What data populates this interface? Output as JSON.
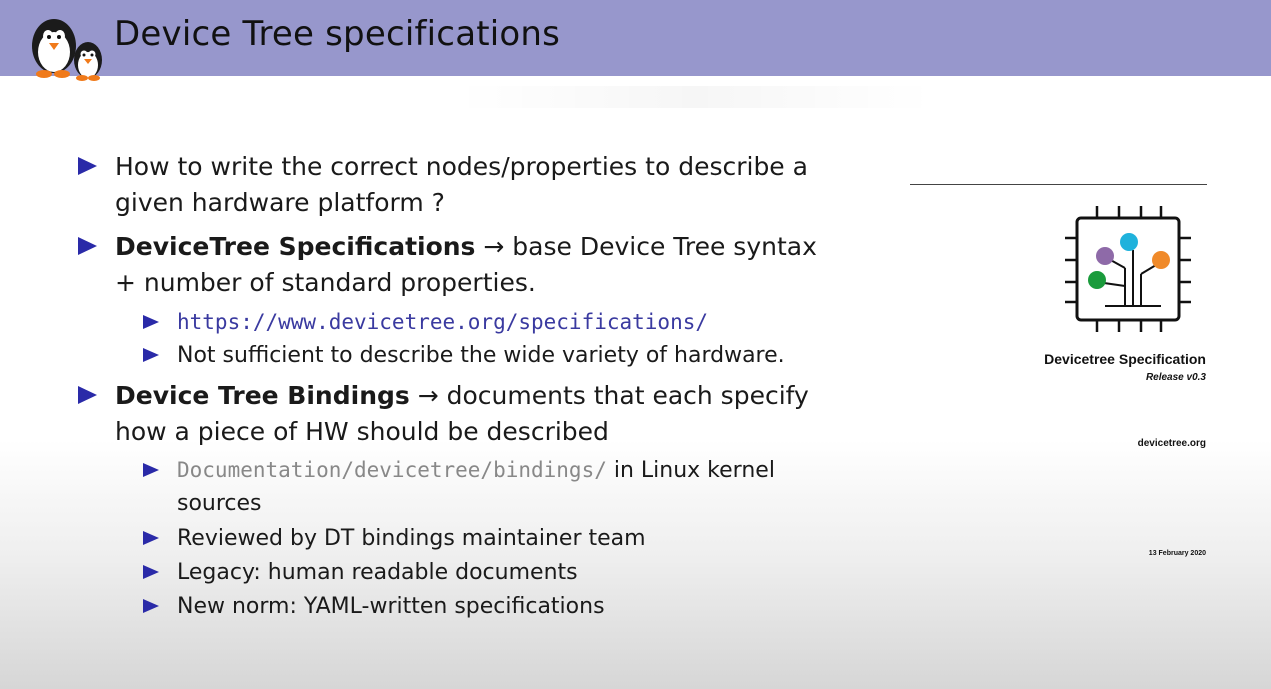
{
  "slide": {
    "title": "Device Tree specifications"
  },
  "bullets": {
    "b1": {
      "text": "How to write the correct nodes/properties to describe a given hardware platform ?"
    },
    "b2": {
      "bold": "DeviceTree Specifications",
      "arrow": "→",
      "rest": " base Device Tree syntax + number of standard properties."
    },
    "b2_1": {
      "link": "https://www.devicetree.org/specifications/"
    },
    "b2_2": {
      "text": "Not sufficient to describe the wide variety of hardware."
    },
    "b3": {
      "bold": "Device Tree Bindings",
      "arrow": "→",
      "rest": " documents that each specify how a piece of HW should be described"
    },
    "b3_1": {
      "path": "Documentation/devicetree/bindings/",
      "rest": " in Linux kernel sources"
    },
    "b3_2": {
      "text": "Reviewed by DT bindings maintainer team"
    },
    "b3_3": {
      "text": "Legacy: human readable documents"
    },
    "b3_4": {
      "text": "New norm: YAML-written specifications"
    }
  },
  "cover": {
    "title": "Devicetree Specification",
    "release": "Release v0.3",
    "site": "devicetree.org",
    "date": "13 February 2020",
    "dot_colors": [
      "#8e6aa8",
      "#1fb2dc",
      "#f08a2a",
      "#1a9b3c"
    ]
  },
  "colors": {
    "titlebar": "#9797cc",
    "bullet": "#2a2aa8",
    "link": "#3a3aa0",
    "path": "#888888"
  }
}
